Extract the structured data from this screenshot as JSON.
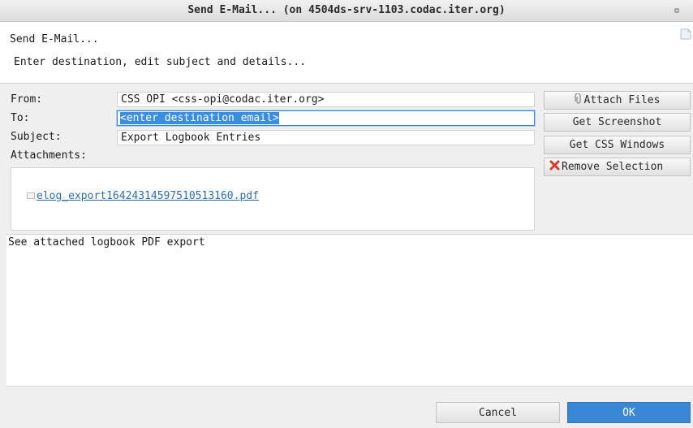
{
  "window": {
    "title": "Send E-Mail...  (on 4504ds-srv-1103.codac.iter.org)"
  },
  "header": {
    "title": "Send E-Mail...",
    "description": "Enter destination, edit subject and details..."
  },
  "form": {
    "from_label": "From:",
    "from_value": "CSS OPI <css-opi@codac.iter.org>",
    "to_label": "To:",
    "to_value": "<enter destination email>",
    "subject_label": "Subject:",
    "subject_value": "Export Logbook Entries",
    "attachments_label": "Attachments:",
    "attachments": [
      {
        "filename": "elog_export16424314597510513160.pdf"
      }
    ]
  },
  "side_buttons": {
    "attach_files": "Attach Files",
    "get_screenshot": "Get Screenshot",
    "get_css_windows": "Get CSS Windows",
    "remove_selection": "Remove Selection"
  },
  "body": {
    "text": "See attached logbook PDF export"
  },
  "footer": {
    "cancel_label": "Cancel",
    "ok_label": "OK"
  },
  "colors": {
    "accent": "#3a87d6",
    "link": "#2f6db5",
    "remove_icon": "#d83a2a"
  }
}
